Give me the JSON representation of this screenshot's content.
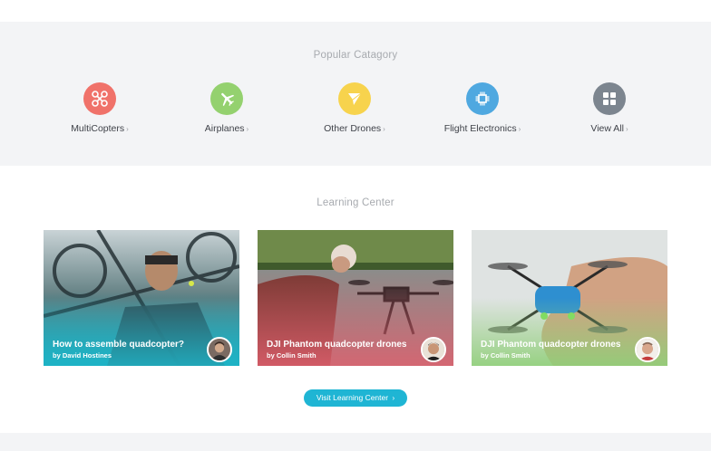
{
  "categories_section": {
    "title": "Popular Catagory",
    "items": [
      {
        "label": "MultiCopters",
        "chevron": "›",
        "icon": "quadcopter-icon",
        "color": "#f0726a"
      },
      {
        "label": "Airplanes",
        "chevron": "›",
        "icon": "airplane-icon",
        "color": "#94d16f"
      },
      {
        "label": "Other Drones",
        "chevron": "›",
        "icon": "paper-plane-icon",
        "color": "#f7d34d"
      },
      {
        "label": "Flight Electronics",
        "chevron": "›",
        "icon": "chip-icon",
        "color": "#4fa8e0"
      },
      {
        "label": "View All",
        "chevron": "›",
        "icon": "grid-icon",
        "color": "#7c858f"
      }
    ]
  },
  "learning_section": {
    "title": "Learning Center",
    "cards": [
      {
        "title": "How to assemble quadcopter?",
        "author": "by David Hostines",
        "tint": "#1fb5c8"
      },
      {
        "title": "DJI Phantom quadcopter drones",
        "author": "by Collin Smith",
        "tint": "#e0606e"
      },
      {
        "title": "DJI Phantom quadcopter drones",
        "author": "by Collin Smith",
        "tint": "#8fcf78"
      }
    ],
    "button_label": "Visit Learning Center",
    "button_chevron": "›"
  }
}
